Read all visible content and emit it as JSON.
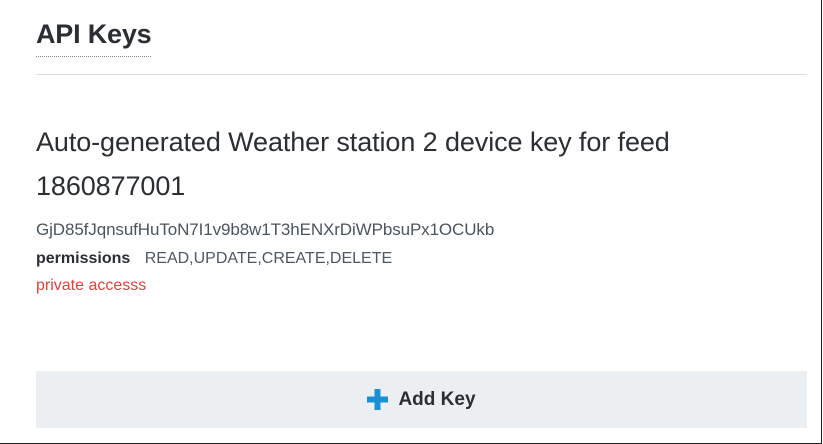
{
  "panel": {
    "title": "API Keys"
  },
  "key": {
    "name": "Auto-generated Weather station 2 device key for feed 1860877001",
    "value": "GjD85fJqnsufHuToN7I1v9b8w1T3hENXrDiWPbsuPx1OCUkb",
    "permissions_label": "permissions",
    "permissions": "READ,UPDATE,CREATE,DELETE",
    "access": "private accesss"
  },
  "actions": {
    "add_key_label": "Add Key",
    "add_icon": "plus-icon"
  },
  "colors": {
    "plus_icon": "#1b8fd6",
    "access_text": "#e0413b",
    "button_bg": "#eceff2"
  }
}
